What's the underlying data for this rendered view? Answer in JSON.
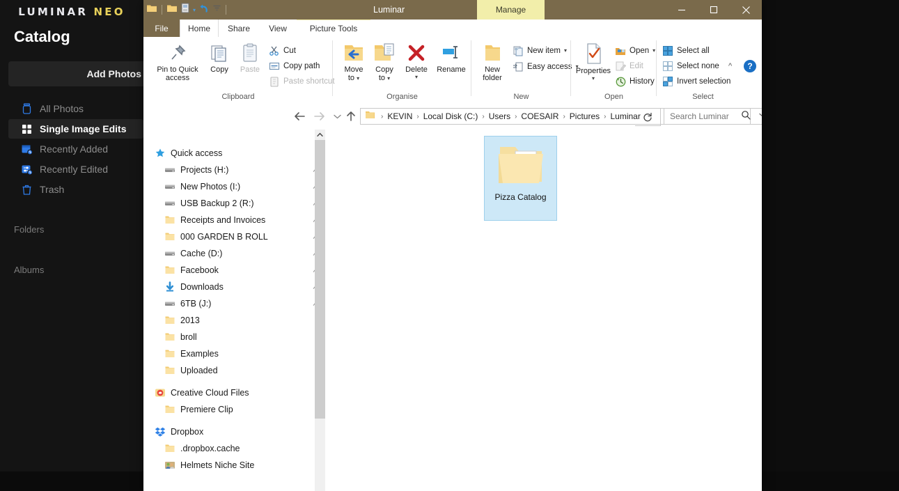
{
  "luminar": {
    "brand_main": "LUMINAR",
    "brand_accent": "NEO",
    "title": "Catalog",
    "add_photos_label": "Add Photos",
    "nav_items": [
      {
        "label": "All Photos",
        "icon": "jar-icon",
        "selected": false
      },
      {
        "label": "Single Image Edits",
        "icon": "grid-icon",
        "selected": true
      },
      {
        "label": "Recently Added",
        "icon": "calendar-clock-icon",
        "selected": false
      },
      {
        "label": "Recently Edited",
        "icon": "sliders-clock-icon",
        "selected": false
      },
      {
        "label": "Trash",
        "icon": "trash-icon",
        "selected": false
      }
    ],
    "sections": [
      {
        "label": "Folders"
      },
      {
        "label": "Albums"
      }
    ],
    "accent_color": "#2f7ae5",
    "neo_color": "#e8d15a"
  },
  "explorer": {
    "window_title": "Luminar",
    "contextual_tab": "Manage",
    "quick_access_icons": [
      "folder-icon",
      "folder-properties-icon",
      "qat-dropdown-icon",
      "undo-icon",
      "qat-more-icon"
    ],
    "window_buttons": {
      "minimize": "minimize-icon",
      "maximize": "maximize-icon",
      "close": "close-icon"
    },
    "tabs": [
      {
        "label": "File",
        "id": "file",
        "active": false
      },
      {
        "label": "Home",
        "id": "home",
        "active": true
      },
      {
        "label": "Share",
        "id": "share",
        "active": false
      },
      {
        "label": "View",
        "id": "view",
        "active": false
      },
      {
        "label": "Picture Tools",
        "id": "picture-tools",
        "active": false
      }
    ],
    "ribbon": {
      "groups": [
        {
          "name": "Clipboard",
          "big_buttons": [
            {
              "label": "Pin to Quick\naccess",
              "line1": "Pin to Quick",
              "line2": "access",
              "icon": "pin-icon",
              "disabled": false
            },
            {
              "label": "Copy",
              "line1": "Copy",
              "line2": "",
              "icon": "copy-icon",
              "disabled": false
            },
            {
              "label": "Paste",
              "line1": "Paste",
              "line2": "",
              "icon": "paste-icon",
              "disabled": true
            }
          ],
          "small_buttons": [
            {
              "label": "Cut",
              "icon": "scissors-icon",
              "disabled": false
            },
            {
              "label": "Copy path",
              "icon": "copy-path-icon",
              "disabled": false
            },
            {
              "label": "Paste shortcut",
              "icon": "paste-shortcut-icon",
              "disabled": true
            }
          ]
        },
        {
          "name": "Organise",
          "big_buttons": [
            {
              "label": "Move to",
              "line1": "Move",
              "line2": "to",
              "icon": "move-to-icon",
              "disabled": false,
              "dropdown": true
            },
            {
              "label": "Copy to",
              "line1": "Copy",
              "line2": "to",
              "icon": "copy-to-icon",
              "disabled": false,
              "dropdown": true
            },
            {
              "label": "Delete",
              "line1": "Delete",
              "line2": "",
              "icon": "delete-icon",
              "disabled": false,
              "dropdown": true
            },
            {
              "label": "Rename",
              "line1": "Rename",
              "line2": "",
              "icon": "rename-icon",
              "disabled": false
            }
          ],
          "small_buttons": []
        },
        {
          "name": "New",
          "big_buttons": [
            {
              "label": "New folder",
              "line1": "New",
              "line2": "folder",
              "icon": "new-folder-icon",
              "disabled": false
            }
          ],
          "small_buttons": [
            {
              "label": "New item",
              "icon": "new-item-icon",
              "disabled": false,
              "dropdown": true
            },
            {
              "label": "Easy access",
              "icon": "easy-access-icon",
              "disabled": false,
              "dropdown": true
            }
          ]
        },
        {
          "name": "Open",
          "big_buttons": [
            {
              "label": "Properties",
              "line1": "Properties",
              "line2": "",
              "icon": "properties-icon",
              "disabled": false,
              "dropdown": true
            }
          ],
          "small_buttons": [
            {
              "label": "Open",
              "icon": "open-icon",
              "disabled": false,
              "dropdown": true
            },
            {
              "label": "Edit",
              "icon": "edit-icon",
              "disabled": true
            },
            {
              "label": "History",
              "icon": "history-icon",
              "disabled": false
            }
          ]
        },
        {
          "name": "Select",
          "big_buttons": [],
          "small_buttons": [
            {
              "label": "Select all",
              "icon": "select-all-icon",
              "disabled": false
            },
            {
              "label": "Select none",
              "icon": "select-none-icon",
              "disabled": false
            },
            {
              "label": "Invert selection",
              "icon": "invert-selection-icon",
              "disabled": false
            }
          ]
        }
      ],
      "collapse_label": "^",
      "help_label": "?"
    },
    "address": {
      "back_icon": "arrow-left-icon",
      "forward_icon": "arrow-right-icon",
      "recent_icon": "chevron-down-icon",
      "up_icon": "arrow-up-icon",
      "breadcrumbs": [
        "KEVIN",
        "Local Disk (C:)",
        "Users",
        "COESAIR",
        "Pictures",
        "Luminar"
      ],
      "separator": "›",
      "dropdown_icon": "chevron-down-icon",
      "refresh_icon": "refresh-icon",
      "search_placeholder": "Search Luminar",
      "search_value": "",
      "search_icon": "magnifier-icon"
    },
    "nav_tree": [
      {
        "label": "Quick access",
        "icon": "star-icon",
        "indent": 0,
        "pinned": false
      },
      {
        "label": "Projects (H:)",
        "icon": "drive-icon",
        "indent": 1,
        "pinned": true
      },
      {
        "label": "New Photos (I:)",
        "icon": "drive-icon",
        "indent": 1,
        "pinned": true
      },
      {
        "label": "USB Backup 2 (R:)",
        "icon": "drive-icon",
        "indent": 1,
        "pinned": true
      },
      {
        "label": "Receipts and Invoices",
        "icon": "folder-icon",
        "indent": 1,
        "pinned": true
      },
      {
        "label": "000 GARDEN B ROLL",
        "icon": "folder-icon",
        "indent": 1,
        "pinned": true
      },
      {
        "label": "Cache (D:)",
        "icon": "drive-icon",
        "indent": 1,
        "pinned": true
      },
      {
        "label": "Facebook",
        "icon": "folder-icon",
        "indent": 1,
        "pinned": true
      },
      {
        "label": "Downloads",
        "icon": "download-icon",
        "indent": 1,
        "pinned": true
      },
      {
        "label": "6TB (J:)",
        "icon": "drive-icon",
        "indent": 1,
        "pinned": true
      },
      {
        "label": "2013",
        "icon": "folder-icon",
        "indent": 1,
        "pinned": false
      },
      {
        "label": "broll",
        "icon": "folder-icon",
        "indent": 1,
        "pinned": false
      },
      {
        "label": "Examples",
        "icon": "folder-icon",
        "indent": 1,
        "pinned": false
      },
      {
        "label": "Uploaded",
        "icon": "folder-icon",
        "indent": 1,
        "pinned": false
      },
      {
        "label": "Creative Cloud Files",
        "icon": "creative-cloud-icon",
        "indent": 0,
        "pinned": false
      },
      {
        "label": "Premiere Clip",
        "icon": "folder-icon",
        "indent": 1,
        "pinned": false
      },
      {
        "label": "Dropbox",
        "icon": "dropbox-icon",
        "indent": 0,
        "pinned": false
      },
      {
        "label": ".dropbox.cache",
        "icon": "folder-icon",
        "indent": 1,
        "pinned": false
      },
      {
        "label": "Helmets Niche Site",
        "icon": "people-folder-icon",
        "indent": 1,
        "pinned": false
      }
    ],
    "content": {
      "items": [
        {
          "name": "Pizza Catalog",
          "icon": "luminar-catalog-folder-icon",
          "selected": true
        }
      ]
    },
    "scrollbar": {
      "up_arrow": "chevron-up-icon"
    }
  }
}
